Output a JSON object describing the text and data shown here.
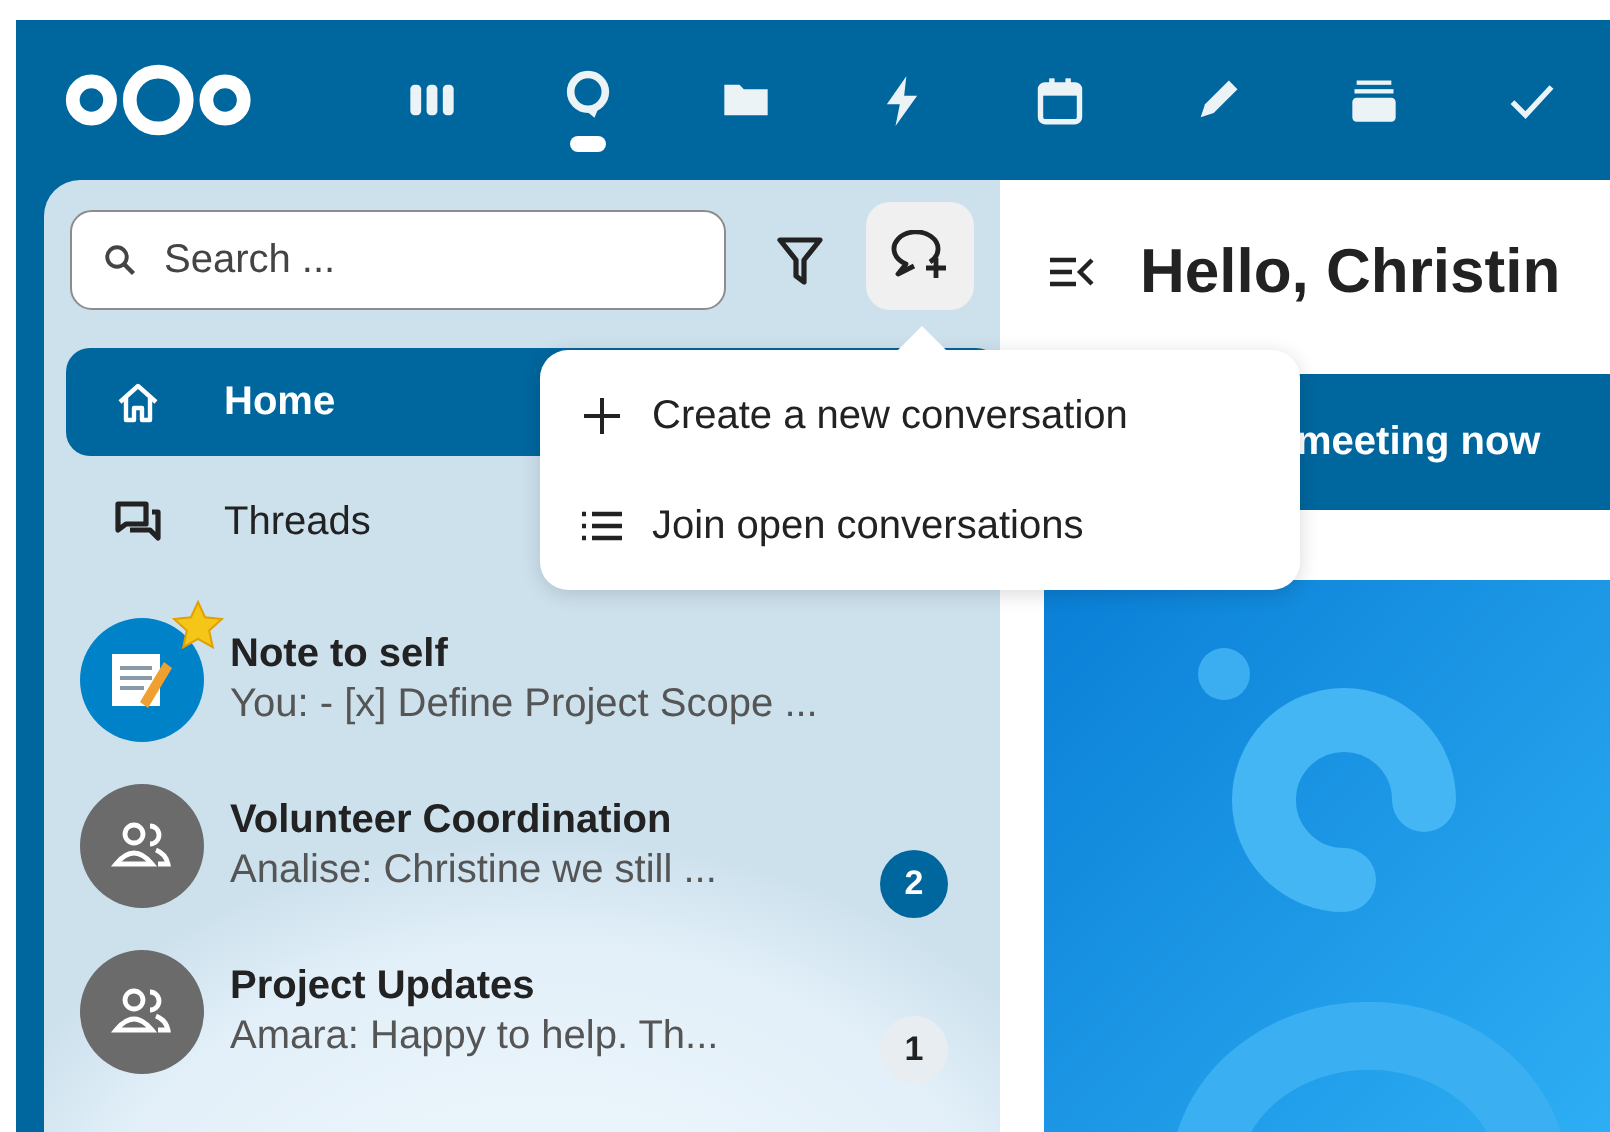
{
  "nav": {
    "apps": [
      {
        "kind": "columns",
        "selected": false
      },
      {
        "kind": "chat",
        "selected": true
      },
      {
        "kind": "folder",
        "selected": false
      },
      {
        "kind": "bolt",
        "selected": false
      },
      {
        "kind": "calendar",
        "selected": false
      },
      {
        "kind": "pencil",
        "selected": false
      },
      {
        "kind": "stack",
        "selected": false
      },
      {
        "kind": "check",
        "selected": false
      }
    ]
  },
  "sidebar": {
    "search": {
      "placeholder": "Search ..."
    },
    "items": [
      {
        "kind": "home",
        "label": "Home",
        "selected": true
      },
      {
        "kind": "threads",
        "label": "Threads",
        "selected": false
      }
    ],
    "conversations": [
      {
        "kind": "note",
        "name": "Note to self",
        "preview": "You: - [x] Define Project Scope ...",
        "favorite": true
      },
      {
        "kind": "group",
        "name": "Volunteer Coordination",
        "preview": "Analise: Christine we still ...",
        "favorite": false,
        "unread": "2",
        "mention": true
      },
      {
        "kind": "group",
        "name": "Project Updates",
        "preview": "Amara: Happy to help. Th...",
        "favorite": false,
        "unread": "1",
        "mention": false
      }
    ]
  },
  "menu": {
    "items": [
      {
        "kind": "create",
        "label": "Create a new conversation"
      },
      {
        "kind": "join",
        "label": "Join open conversations"
      }
    ]
  },
  "main": {
    "title": "Hello, Christin",
    "banner": "meeting now"
  }
}
